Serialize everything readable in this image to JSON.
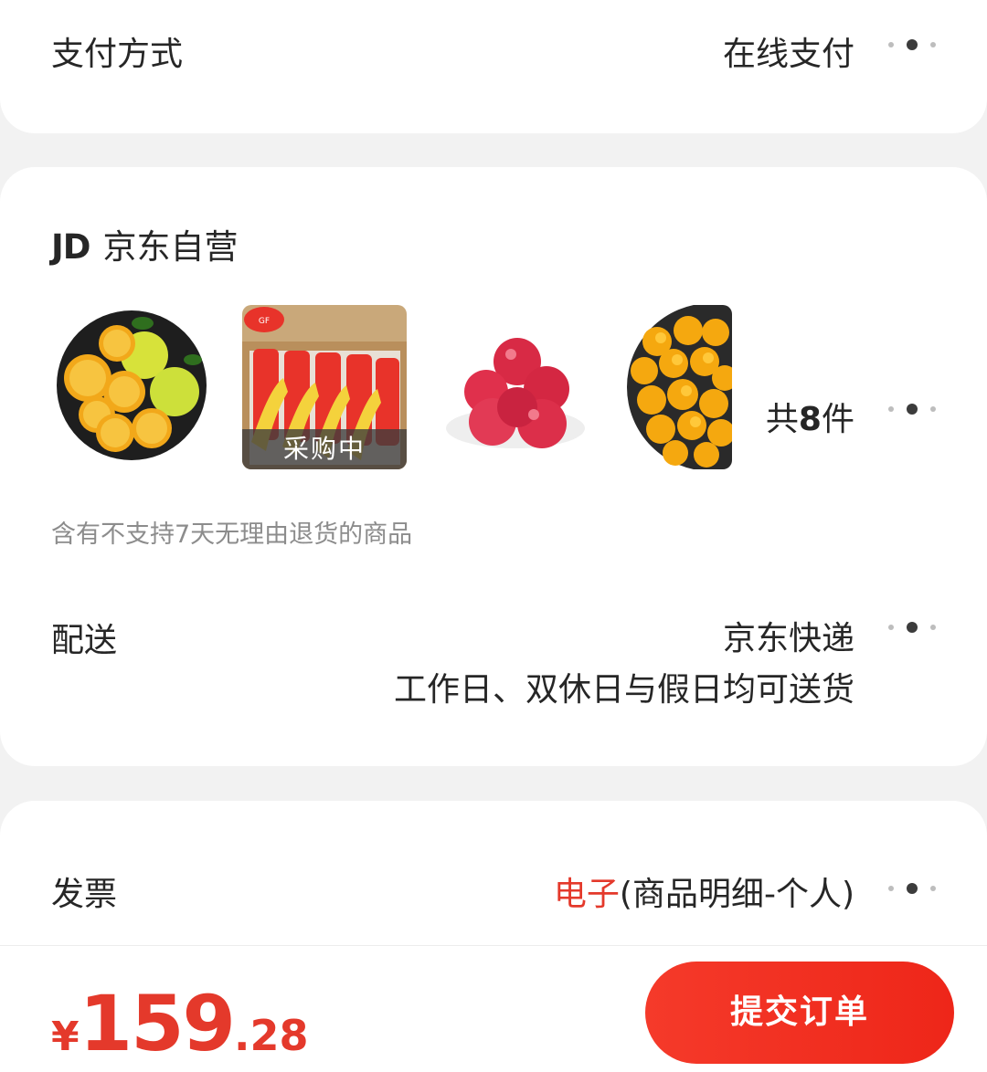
{
  "payment": {
    "label": "支付方式",
    "value": "在线支付"
  },
  "shop": {
    "badge": "JD",
    "name": "京东自营",
    "products": [
      {
        "icon": "orange-halves-image"
      },
      {
        "icon": "banana-box-image",
        "tag": "采购中"
      },
      {
        "icon": "apple-pile-image"
      },
      {
        "icon": "small-oranges-image"
      }
    ],
    "total_prefix": "共",
    "total_count": "8",
    "total_suffix": "件",
    "notice": "含有不支持7天无理由退货的商品"
  },
  "delivery": {
    "label": "配送",
    "method": "京东快递",
    "schedule": "工作日、双休日与假日均可送货"
  },
  "invoice": {
    "label": "发票",
    "type": "电子",
    "detail": "(商品明细-个人)"
  },
  "checkout": {
    "currency": "¥",
    "price_int": "159",
    "price_dec": ".28",
    "submit_label": "提交订单"
  },
  "colors": {
    "accent": "#e4392b",
    "button": "#f03020"
  }
}
